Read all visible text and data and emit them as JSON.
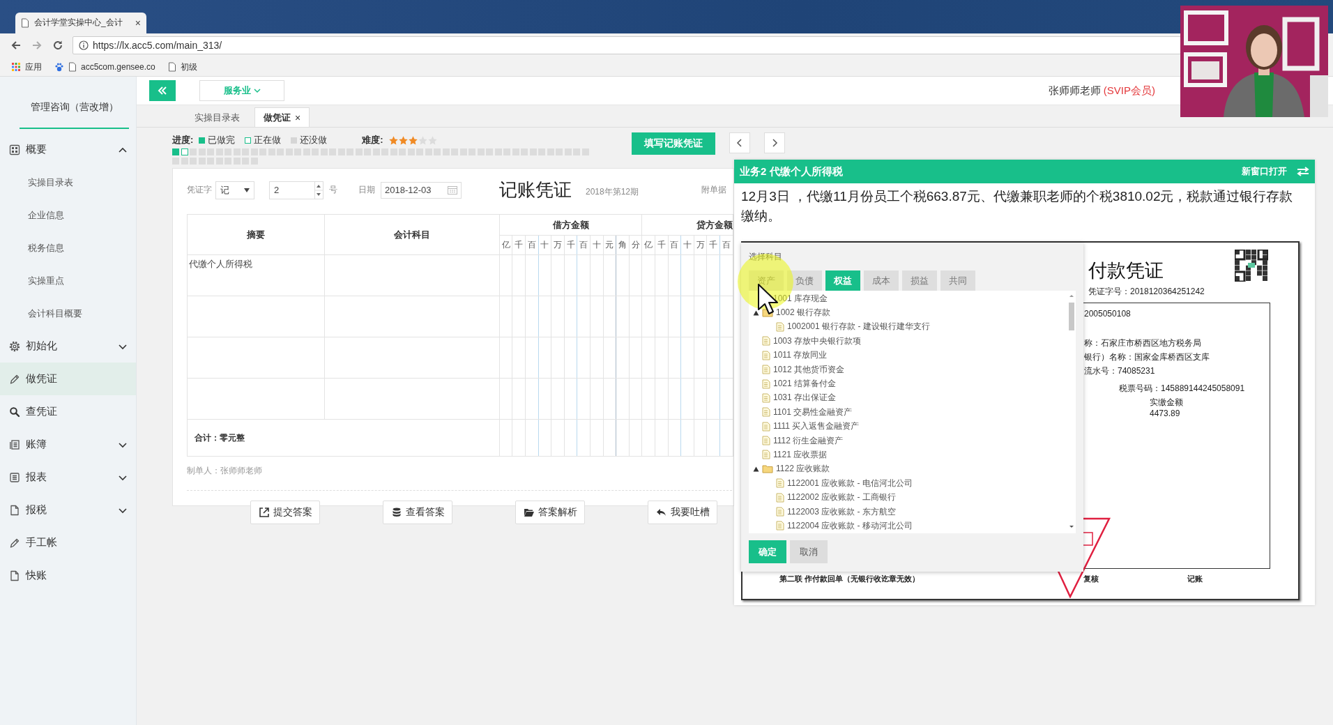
{
  "browser": {
    "tab_title": "会计学堂实操中心_会计",
    "tab_close": "×",
    "url": "https://lx.acc5.com/main_313/",
    "bookmarks": [
      "应用",
      "acc5com.gensee.co",
      "初级"
    ]
  },
  "sidebar": {
    "title": "管理咨询（营改增）",
    "items": [
      {
        "label": "概要",
        "selected": false,
        "expanded": true,
        "children": [
          {
            "label": "实操目录表",
            "selected": false
          },
          {
            "label": "企业信息",
            "selected": false
          },
          {
            "label": "税务信息",
            "selected": false
          },
          {
            "label": "实操重点",
            "selected": false
          },
          {
            "label": "会计科目概要",
            "selected": false
          }
        ]
      },
      {
        "label": "初始化",
        "selected": false,
        "expanded": false
      },
      {
        "label": "做凭证",
        "selected": true
      },
      {
        "label": "查凭证",
        "selected": false
      },
      {
        "label": "账簿",
        "selected": false,
        "expanded": false
      },
      {
        "label": "报表",
        "selected": false,
        "expanded": false
      },
      {
        "label": "报税",
        "selected": false,
        "expanded": false
      },
      {
        "label": "手工帐",
        "selected": false
      },
      {
        "label": "快账",
        "selected": false
      }
    ]
  },
  "header": {
    "industry": "服务业",
    "user": "张师师老师",
    "membership": "(SVIP会员)"
  },
  "tabs": [
    {
      "label": "实操目录表",
      "selected": false
    },
    {
      "label": "做凭证",
      "selected": true,
      "close": "×"
    }
  ],
  "progress": {
    "label": "进度:",
    "legend": [
      {
        "kind": "done",
        "label": "已做完"
      },
      {
        "kind": "current",
        "label": "正在做"
      },
      {
        "kind": "todo",
        "label": "还没做"
      }
    ],
    "difficulty_label": "难度:",
    "stars": 3,
    "cells": [
      {
        "kind": "done"
      },
      {
        "kind": "current"
      },
      {
        "kind": "todo"
      },
      {
        "kind": "todo"
      },
      {
        "kind": "todo"
      },
      {
        "kind": "todo"
      },
      {
        "kind": "todo"
      },
      {
        "kind": "todo"
      },
      {
        "kind": "todo"
      },
      {
        "kind": "todo"
      },
      {
        "kind": "todo"
      },
      {
        "kind": "todo"
      },
      {
        "kind": "todo"
      },
      {
        "kind": "todo"
      },
      {
        "kind": "todo"
      },
      {
        "kind": "todo"
      },
      {
        "kind": "todo"
      },
      {
        "kind": "todo"
      },
      {
        "kind": "todo"
      },
      {
        "kind": "todo"
      },
      {
        "kind": "todo"
      },
      {
        "kind": "todo"
      },
      {
        "kind": "todo"
      },
      {
        "kind": "todo"
      },
      {
        "kind": "todo"
      },
      {
        "kind": "todo"
      },
      {
        "kind": "todo"
      },
      {
        "kind": "todo"
      },
      {
        "kind": "todo"
      },
      {
        "kind": "todo"
      },
      {
        "kind": "todo"
      },
      {
        "kind": "todo"
      },
      {
        "kind": "todo"
      },
      {
        "kind": "todo"
      },
      {
        "kind": "todo"
      },
      {
        "kind": "todo"
      },
      {
        "kind": "todo"
      },
      {
        "kind": "todo"
      },
      {
        "kind": "todo"
      },
      {
        "kind": "todo"
      },
      {
        "kind": "todo"
      },
      {
        "kind": "todo"
      },
      {
        "kind": "todo"
      },
      {
        "kind": "todo"
      },
      {
        "kind": "todo"
      },
      {
        "kind": "todo"
      },
      {
        "kind": "todo"
      },
      {
        "kind": "todo"
      },
      {
        "kind": "todo"
      },
      {
        "kind": "todo"
      },
      {
        "kind": "todo"
      },
      {
        "kind": "todo"
      },
      {
        "kind": "todo"
      },
      {
        "kind": "todo"
      },
      {
        "kind": "todo"
      },
      {
        "kind": "todo"
      },
      {
        "kind": "todo"
      },
      {
        "kind": "todo"
      }
    ],
    "fill_button": "填写记账凭证"
  },
  "voucher": {
    "type_label": "凭证字",
    "type": "记",
    "number": "2",
    "number_suffix": "号",
    "date_label": "日期",
    "date": "2018-12-03",
    "title": "记账凭证",
    "period": "2018年第12期",
    "attachments_label": "附单据",
    "columns": {
      "summary": "摘要",
      "account": "会计科目",
      "debit": "借方金额",
      "credit": "贷方金额"
    },
    "debit_units": [
      "亿",
      "千",
      "百",
      "十",
      "万",
      "千",
      "百",
      "十",
      "元",
      "角",
      "分"
    ],
    "credit_units": [
      "亿",
      "千",
      "百",
      "十",
      "万",
      "千",
      "百"
    ],
    "rows": [
      {
        "summary": "代缴个人所得税"
      }
    ],
    "total": "合计：零元整",
    "maker": "制单人：张师师老师",
    "buttons": [
      {
        "label": "提交答案"
      },
      {
        "label": "查看答案"
      },
      {
        "label": "答案解析"
      },
      {
        "label": "我要吐槽"
      }
    ]
  },
  "task": {
    "title": "业务2 代缴个人所得税",
    "open_new": "新窗口打开",
    "description": "12月3日 ，代缴11月份员工个税663.87元、代缴兼职老师的个税3810.02元，税款通过银行存款缴纳。",
    "document": {
      "title": "付款凭证",
      "voucher_no": "凭证字号：2018120364251242",
      "lines": [
        "2005050108",
        "称：石家庄市桥西区地方税务局",
        "银行）名称：国家金库桥西区支库",
        "流水号：74085231"
      ],
      "ticket_no": "税票号码：145889144245058091",
      "amount_label": "实缴金额",
      "amount": "4473.89",
      "footer": "第二联  作付款回单（无银行收讫章无效）",
      "review": "复核",
      "bookkeeping": "记账"
    }
  },
  "dialog": {
    "title": "选择科目",
    "tabs": [
      {
        "label": "资产",
        "selected": false
      },
      {
        "label": "负债",
        "selected": false
      },
      {
        "label": "权益",
        "selected": true
      },
      {
        "label": "成本",
        "selected": false
      },
      {
        "label": "损益",
        "selected": false
      },
      {
        "label": "共同",
        "selected": false
      }
    ],
    "tree": [
      {
        "label": "1001 库存现金"
      },
      {
        "label": "1002 银行存款",
        "expanded": true,
        "children": [
          {
            "label": "1002001 银行存款 - 建设银行建华支行"
          }
        ]
      },
      {
        "label": "1003 存放中央银行款项"
      },
      {
        "label": "1011 存放同业"
      },
      {
        "label": "1012 其他货币资金"
      },
      {
        "label": "1021 结算备付金"
      },
      {
        "label": "1031 存出保证金"
      },
      {
        "label": "1101 交易性金融资产"
      },
      {
        "label": "1111 买入返售金融资产"
      },
      {
        "label": "1112 衍生金融资产"
      },
      {
        "label": "1121 应收票据"
      },
      {
        "label": "1122 应收账款",
        "expanded": true,
        "children": [
          {
            "label": "1122001 应收账款 - 电信河北公司"
          },
          {
            "label": "1122002 应收账款 - 工商银行"
          },
          {
            "label": "1122003 应收账款 - 东方航空"
          },
          {
            "label": "1122004 应收账款 - 移动河北公司"
          }
        ]
      }
    ],
    "ok": "确定",
    "cancel": "取消"
  }
}
